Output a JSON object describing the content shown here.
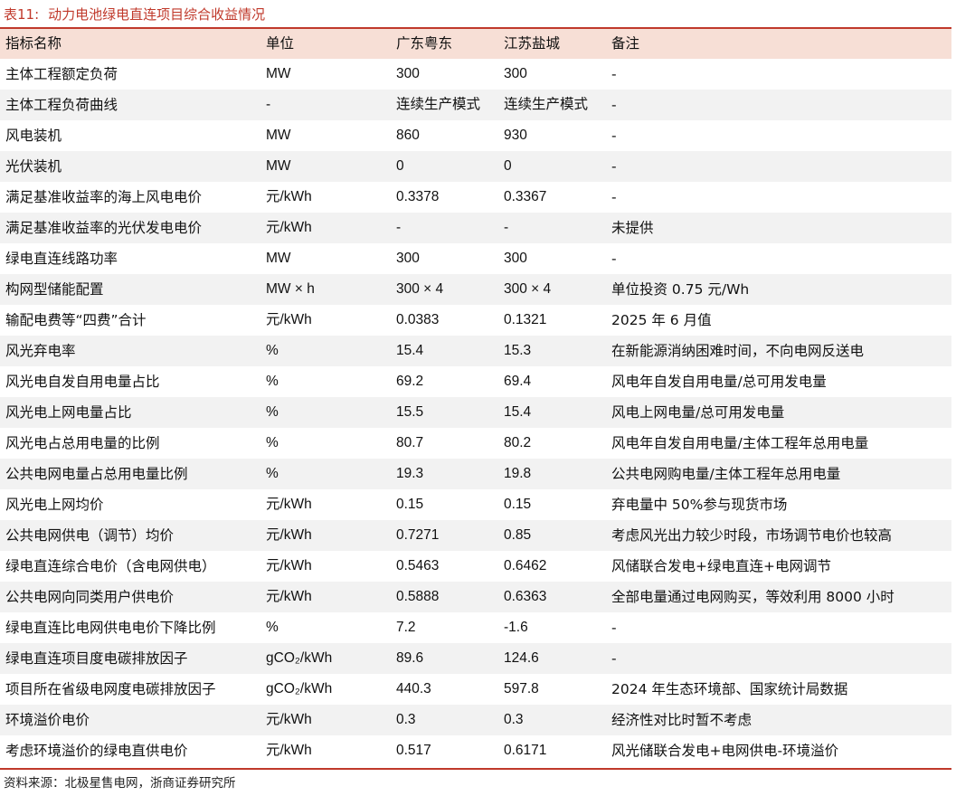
{
  "caption": {
    "label": "表11:",
    "text": "动力电池绿电直连项目综合收益情况"
  },
  "table": {
    "headers": [
      "指标名称",
      "单位",
      "广东粤东",
      "江苏盐城",
      "备注"
    ],
    "rows": [
      [
        "主体工程额定负荷",
        "MW",
        "300",
        "300",
        "-"
      ],
      [
        "主体工程负荷曲线",
        "-",
        "连续生产模式",
        "连续生产模式",
        "-"
      ],
      [
        "风电装机",
        "MW",
        "860",
        "930",
        "-"
      ],
      [
        "光伏装机",
        "MW",
        "0",
        "0",
        "-"
      ],
      [
        "满足基准收益率的海上风电电价",
        "元/kWh",
        "0.3378",
        "0.3367",
        "-"
      ],
      [
        "满足基准收益率的光伏发电电价",
        "元/kWh",
        "-",
        "-",
        "未提供"
      ],
      [
        "绿电直连线路功率",
        "MW",
        "300",
        "300",
        "-"
      ],
      [
        "构网型储能配置",
        "MW × h",
        "300 × 4",
        "300 × 4",
        "单位投资 0.75 元/Wh"
      ],
      [
        "输配电费等“四费”合计",
        "元/kWh",
        "0.0383",
        "0.1321",
        "2025 年 6 月值"
      ],
      [
        "风光弃电率",
        "%",
        "15.4",
        "15.3",
        "在新能源消纳困难时间，不向电网反送电"
      ],
      [
        "风光电自发自用电量占比",
        "%",
        "69.2",
        "69.4",
        "风电年自发自用电量/总可用发电量"
      ],
      [
        "风光电上网电量占比",
        "%",
        "15.5",
        "15.4",
        "风电上网电量/总可用发电量"
      ],
      [
        "风光电占总用电量的比例",
        "%",
        "80.7",
        "80.2",
        "风电年自发自用电量/主体工程年总用电量"
      ],
      [
        "公共电网电量占总用电量比例",
        "%",
        "19.3",
        "19.8",
        "公共电网购电量/主体工程年总用电量"
      ],
      [
        "风光电上网均价",
        "元/kWh",
        "0.15",
        "0.15",
        "弃电量中 50%参与现货市场"
      ],
      [
        "公共电网供电（调节）均价",
        "元/kWh",
        "0.7271",
        "0.85",
        "考虑风光出力较少时段，市场调节电价也较高"
      ],
      [
        "绿电直连综合电价（含电网供电）",
        "元/kWh",
        "0.5463",
        "0.6462",
        "风储联合发电+绿电直连+电网调节"
      ],
      [
        "公共电网向同类用户供电价",
        "元/kWh",
        "0.5888",
        "0.6363",
        "全部电量通过电网购买，等效利用 8000 小时"
      ],
      [
        "绿电直连比电网供电电价下降比例",
        "%",
        "7.2",
        "-1.6",
        "-"
      ],
      [
        "绿电直连项目度电碳排放因子",
        "gCO₂/kWh",
        "89.6",
        "124.6",
        "-"
      ],
      [
        "项目所在省级电网度电碳排放因子",
        "gCO₂/kWh",
        "440.3",
        "597.8",
        "2024 年生态环境部、国家统计局数据"
      ],
      [
        "环境溢价电价",
        "元/kWh",
        "0.3",
        "0.3",
        "经济性对比时暂不考虑"
      ],
      [
        "考虑环境溢价的绿电直供电价",
        "元/kWh",
        "0.517",
        "0.6171",
        "风光储联合发电+电网供电-环境溢价"
      ]
    ]
  },
  "source": "资料来源：北极星售电网，浙商证券研究所",
  "colors": {
    "accent": "#c0392b",
    "header_bg": "#f7dfd6",
    "row_shade": "#f2f2f2"
  }
}
